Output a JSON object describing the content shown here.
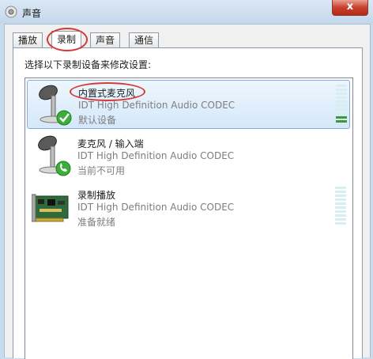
{
  "window": {
    "title": "声音",
    "close_glyph": "x"
  },
  "tabs": [
    {
      "label": "播放",
      "active": false
    },
    {
      "label": "录制",
      "active": true
    },
    {
      "label": "声音",
      "active": false
    },
    {
      "label": "通信",
      "active": false
    }
  ],
  "panel": {
    "instruction": "选择以下录制设备来修改设置:"
  },
  "devices": [
    {
      "name": "内置式麦克风",
      "driver": "IDT High Definition Audio CODEC",
      "status": "默认设备",
      "icon": "microphone-icon",
      "badge": "default-check-icon",
      "level_fraction": 0.2
    },
    {
      "name": "麦克风 / 输入端",
      "driver": "IDT High Definition Audio CODEC",
      "status": "当前不可用",
      "icon": "microphone-icon",
      "badge": "phone-icon"
    },
    {
      "name": "录制播放",
      "driver": "IDT High Definition Audio CODEC",
      "status": "准备就绪",
      "icon": "sound-card-icon",
      "level_fraction": 0
    }
  ],
  "colors": {
    "annotation_circle": "#d43a3a",
    "selection": "#d4e8fa",
    "meter_on": "#3a9a3a"
  }
}
